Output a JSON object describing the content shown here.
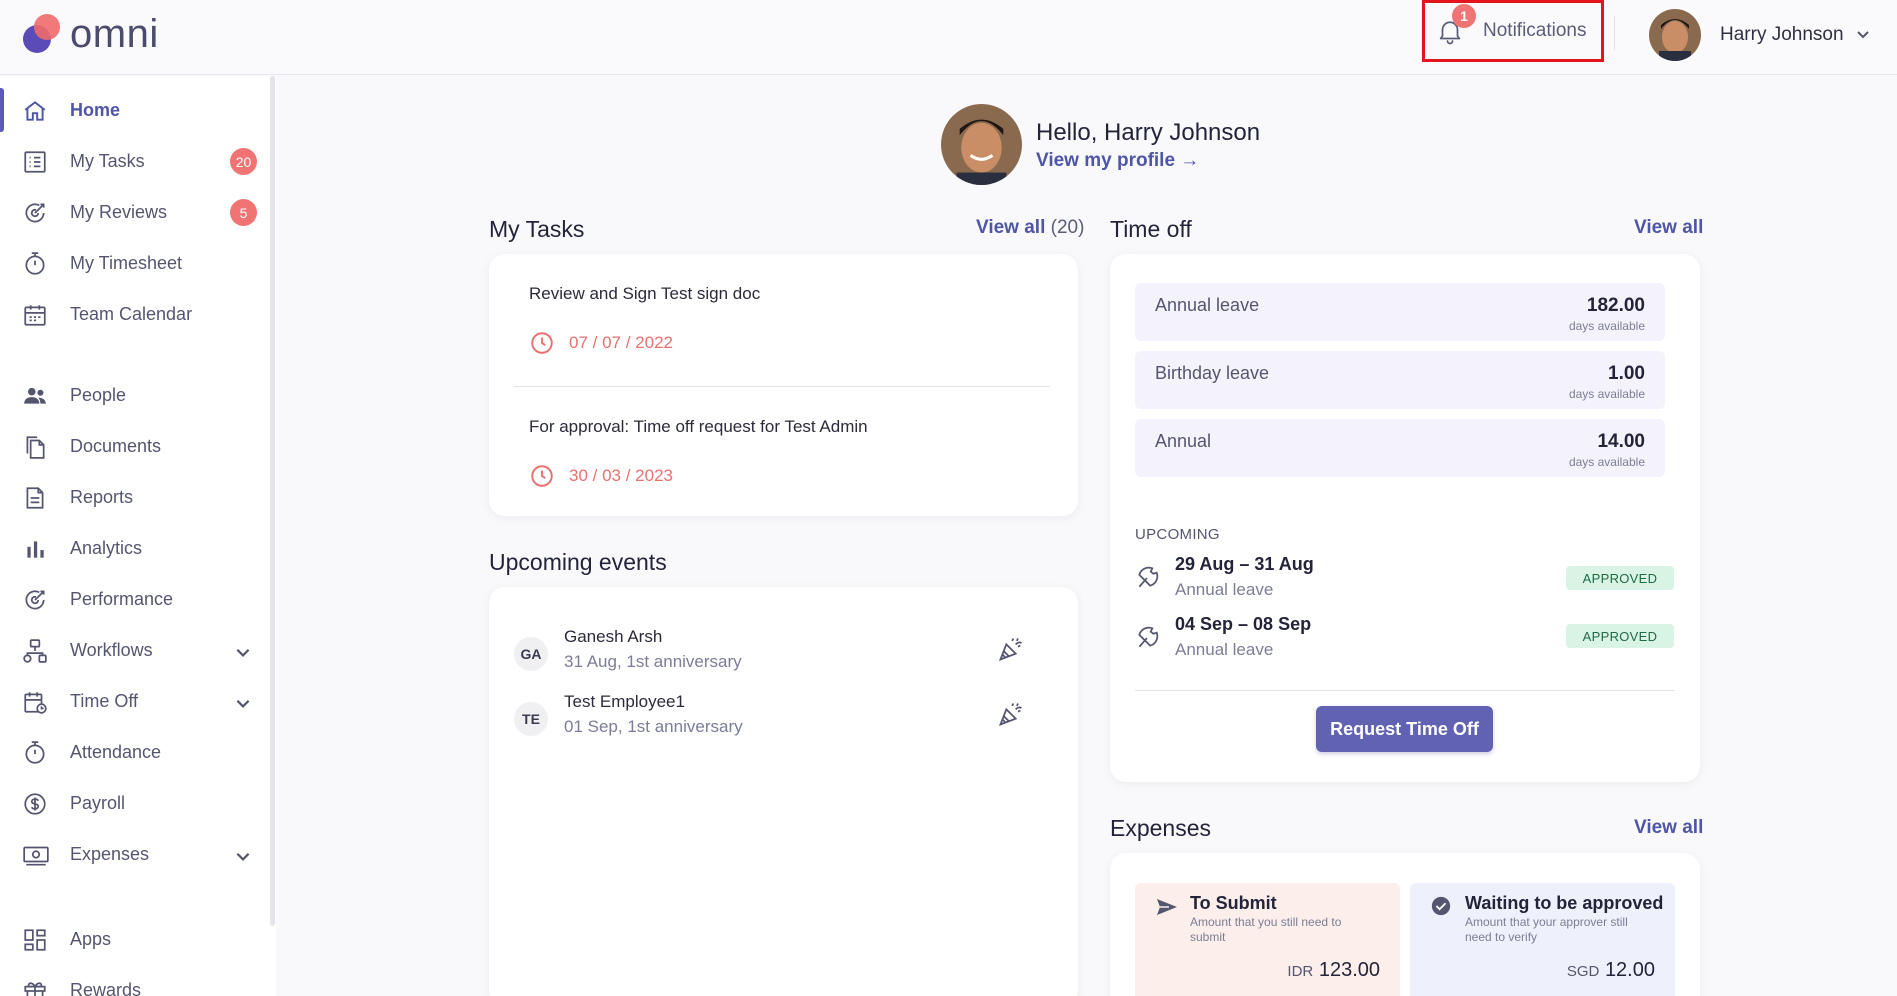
{
  "app": {
    "logo_text": "omni"
  },
  "topbar": {
    "notifications_label": "Notifications",
    "notifications_count": "1",
    "user_name": "Harry Johnson"
  },
  "sidebar": {
    "items": [
      {
        "label": "Home",
        "icon": "home-icon",
        "active": true
      },
      {
        "label": "My Tasks",
        "icon": "tasks-icon",
        "badge": "20"
      },
      {
        "label": "My Reviews",
        "icon": "reviews-icon",
        "badge": "5"
      },
      {
        "label": "My Timesheet",
        "icon": "timer-icon"
      },
      {
        "label": "Team Calendar",
        "icon": "calendar-icon"
      },
      {
        "label": "People",
        "icon": "people-icon"
      },
      {
        "label": "Documents",
        "icon": "documents-icon"
      },
      {
        "label": "Reports",
        "icon": "report-icon"
      },
      {
        "label": "Analytics",
        "icon": "analytics-icon"
      },
      {
        "label": "Performance",
        "icon": "performance-icon"
      },
      {
        "label": "Workflows",
        "icon": "workflow-icon",
        "expandable": true
      },
      {
        "label": "Time Off",
        "icon": "time-off-icon",
        "expandable": true
      },
      {
        "label": "Attendance",
        "icon": "timer-icon"
      },
      {
        "label": "Payroll",
        "icon": "dollar-icon"
      },
      {
        "label": "Expenses",
        "icon": "money-icon",
        "expandable": true
      },
      {
        "label": "Apps",
        "icon": "apps-icon"
      },
      {
        "label": "Rewards",
        "icon": "gift-icon"
      }
    ]
  },
  "greeting": {
    "hello": "Hello, Harry Johnson",
    "profile_link": "View my profile →"
  },
  "my_tasks": {
    "title": "My Tasks",
    "view_all": "View all",
    "view_all_count": "(20)",
    "tasks": [
      {
        "title": "Review and Sign Test sign doc",
        "date": "07 / 07 / 2022"
      },
      {
        "title": "For approval: Time off request for Test Admin",
        "date": "30 / 03 / 2023"
      }
    ]
  },
  "events": {
    "title": "Upcoming events",
    "items": [
      {
        "initials": "GA",
        "name": "Ganesh Arsh",
        "detail": "31 Aug, 1st anniversary"
      },
      {
        "initials": "TE",
        "name": "Test Employee1",
        "detail": "01 Sep, 1st anniversary"
      }
    ]
  },
  "time_off": {
    "title": "Time off",
    "view_all": "View all",
    "balances": [
      {
        "name": "Annual leave",
        "value": "182.00",
        "unit": "days available"
      },
      {
        "name": "Birthday leave",
        "value": "1.00",
        "unit": "days available"
      },
      {
        "name": "Annual",
        "value": "14.00",
        "unit": "days available"
      }
    ],
    "upcoming_label": "UPCOMING",
    "upcoming": [
      {
        "dates": "29 Aug – 31 Aug",
        "type": "Annual leave",
        "status": "APPROVED"
      },
      {
        "dates": "04 Sep – 08 Sep",
        "type": "Annual leave",
        "status": "APPROVED"
      }
    ],
    "request_button": "Request Time Off"
  },
  "expenses": {
    "title": "Expenses",
    "view_all": "View all",
    "to_submit": {
      "title": "To Submit",
      "desc": "Amount that you still need to submit",
      "currency": "IDR",
      "amount": "123.00"
    },
    "waiting": {
      "title": "Waiting to be approved",
      "desc": "Amount that your approver still need to verify",
      "currency": "SGD",
      "amount": "12.00"
    }
  },
  "colors": {
    "accent": "#4f55a7",
    "badge": "#f07474",
    "approved_bg": "#d9f3e4",
    "button": "#6262b2"
  }
}
